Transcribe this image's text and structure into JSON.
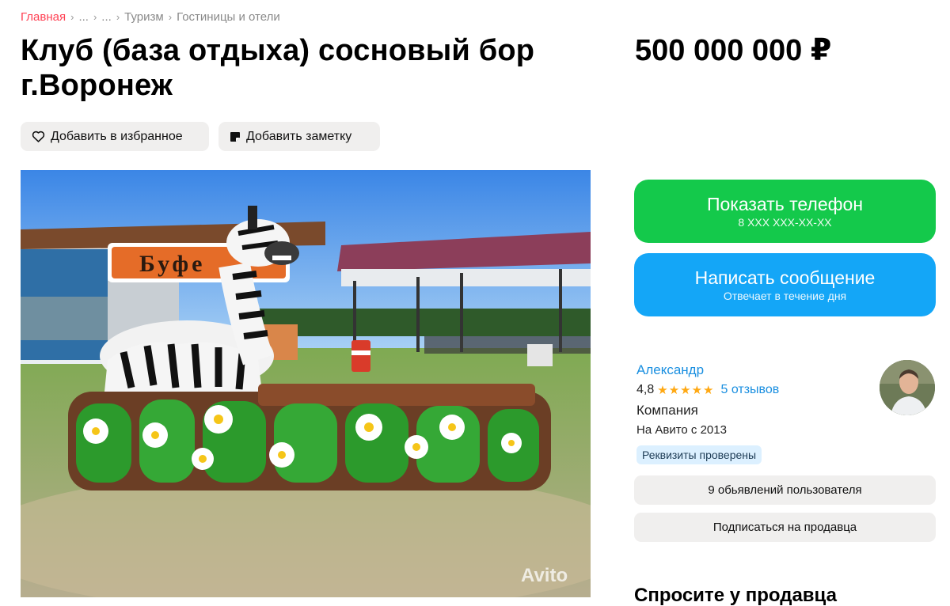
{
  "breadcrumb": {
    "items": [
      "Главная",
      "...",
      "...",
      "Туризм",
      "Гостиницы и отели"
    ],
    "separator": "›"
  },
  "listing": {
    "title": "Клуб (база отдыха) сосновый бор г.Воронеж",
    "price": "500 000 000 ₽"
  },
  "actions": {
    "favorite_label": "Добавить в избранное",
    "note_label": "Добавить заметку"
  },
  "photo": {
    "sign_text": "Буфе",
    "watermark": "Avito"
  },
  "contact": {
    "phone_label": "Показать телефон",
    "phone_masked": "8 XXX XXX-XX-XX",
    "message_label": "Написать сообщение",
    "message_sub": "Отвечает в течение дня"
  },
  "seller": {
    "name": "Александр",
    "rating": "4,8",
    "stars": "★★★★★",
    "reviews": "5 отзывов",
    "type": "Компания",
    "since": "На Авито с 2013",
    "verified_badge": "Реквизиты проверены",
    "listings_button": "9 обьявлений пользователя",
    "subscribe_button": "Подписаться на продавца"
  },
  "ask_heading": "Спросите у продавца",
  "colors": {
    "accent_red": "#ff4053",
    "phone_green": "#14c94b",
    "message_blue": "#14a6f7",
    "link_blue": "#1a8fe0",
    "star_orange": "#ffa812",
    "badge_bg": "#dcf0ff"
  },
  "icons": {
    "favorite": "heart-icon",
    "note": "note-icon",
    "rating": "star-icon"
  }
}
